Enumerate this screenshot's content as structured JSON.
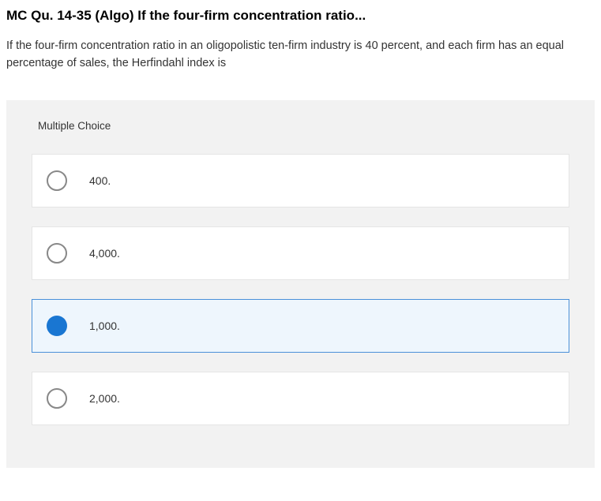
{
  "question": {
    "title": "MC Qu. 14-35 (Algo) If the four-firm concentration ratio...",
    "text": "If the four-firm concentration ratio in an oligopolistic ten-firm industry is 40 percent, and each firm has an equal percentage of sales, the Herfindahl index is"
  },
  "section_label": "Multiple Choice",
  "options": [
    {
      "label": "400.",
      "selected": false
    },
    {
      "label": "4,000.",
      "selected": false
    },
    {
      "label": "1,000.",
      "selected": true
    },
    {
      "label": "2,000.",
      "selected": false
    }
  ]
}
